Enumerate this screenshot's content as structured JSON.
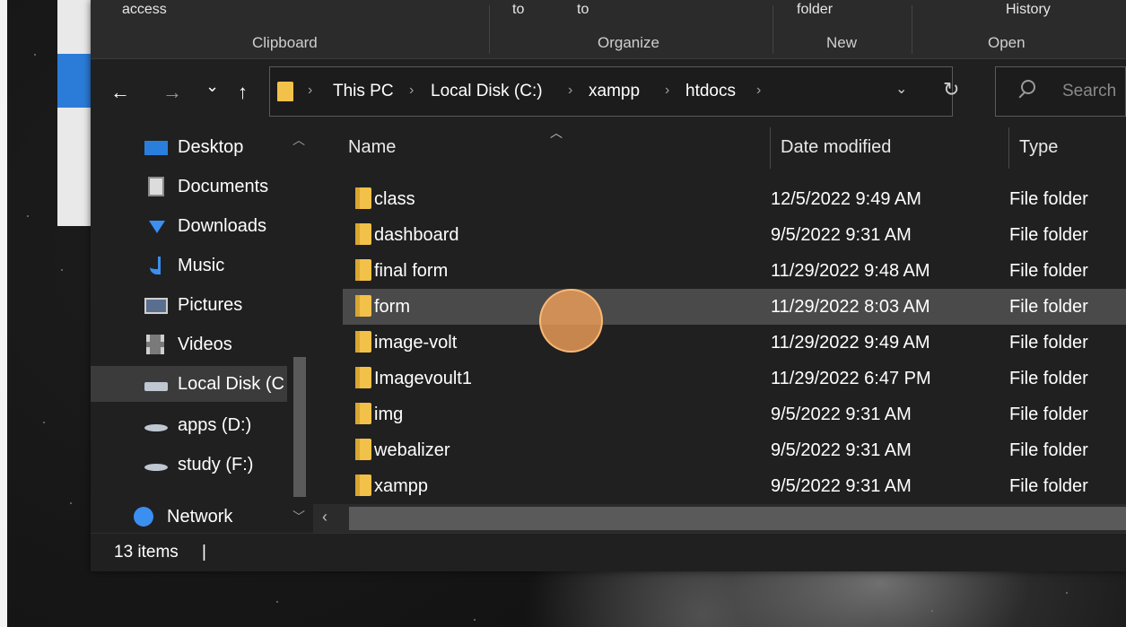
{
  "ribbon": {
    "fragments": [
      "access",
      "to",
      "to",
      "folder",
      "History"
    ],
    "groups": [
      "Clipboard",
      "Organize",
      "New",
      "Open"
    ]
  },
  "nav": {
    "back": "←",
    "forward": "→",
    "recent": "⌄",
    "up": "↑",
    "refresh": "↻"
  },
  "address": {
    "crumbs": [
      "This PC",
      "Local Disk (C:)",
      "xampp",
      "htdocs"
    ],
    "separator": "›"
  },
  "search": {
    "placeholder": "Search"
  },
  "sidebar": {
    "items": [
      {
        "label": "Desktop",
        "icon": "desktop-icon"
      },
      {
        "label": "Documents",
        "icon": "documents-icon"
      },
      {
        "label": "Downloads",
        "icon": "downloads-icon"
      },
      {
        "label": "Music",
        "icon": "music-icon"
      },
      {
        "label": "Pictures",
        "icon": "pictures-icon"
      },
      {
        "label": "Videos",
        "icon": "videos-icon"
      },
      {
        "label": "Local Disk (C",
        "icon": "drive-icon",
        "selected": true
      },
      {
        "label": "apps (D:)",
        "icon": "drive-icon"
      },
      {
        "label": "study (F:)",
        "icon": "drive-icon"
      },
      {
        "label": "Network",
        "icon": "network-icon"
      }
    ]
  },
  "columns": {
    "name": "Name",
    "date": "Date modified",
    "type": "Type"
  },
  "files": [
    {
      "name": "class",
      "date": "12/5/2022 9:49 AM",
      "type": "File folder"
    },
    {
      "name": "dashboard",
      "date": "9/5/2022 9:31 AM",
      "type": "File folder"
    },
    {
      "name": "final form",
      "date": "11/29/2022 9:48 AM",
      "type": "File folder"
    },
    {
      "name": "form",
      "date": "11/29/2022 8:03 AM",
      "type": "File folder",
      "hover": true
    },
    {
      "name": "image-volt",
      "date": "11/29/2022 9:49 AM",
      "type": "File folder"
    },
    {
      "name": "Imagevoult1",
      "date": "11/29/2022 6:47 PM",
      "type": "File folder"
    },
    {
      "name": "img",
      "date": "9/5/2022 9:31 AM",
      "type": "File folder"
    },
    {
      "name": "webalizer",
      "date": "9/5/2022 9:31 AM",
      "type": "File folder"
    },
    {
      "name": "xampp",
      "date": "9/5/2022 9:31 AM",
      "type": "File folder"
    }
  ],
  "status": {
    "items_count": "13 items",
    "cursor": "|"
  },
  "colors": {
    "folder": "#f2c14a",
    "window_bg": "#202020",
    "hover_row": "#4a4a4a",
    "accent_blue": "#1a6fd0",
    "click_marker": "#f0a05a"
  }
}
